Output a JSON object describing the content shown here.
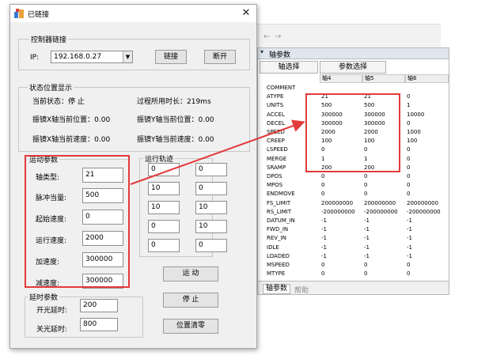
{
  "dialog": {
    "title": "已链接",
    "close_glyph": "✕",
    "controller_group": {
      "title": "控制器链接",
      "ip_label": "IP:",
      "ip_value": "192.168.0.27",
      "connect_label": "链接",
      "disconnect_label": "断开"
    },
    "status_group": {
      "title": "状态位置显示",
      "current_state": "当前状态：停 止",
      "elapsed": "过程所用时长：219ms",
      "x_pos": "振镜X轴当前位置：0.00",
      "y_pos": "振镜Y轴当前位置：0.00",
      "x_speed": "振镜X轴当前速度：0.00",
      "y_speed": "振镜Y轴当前速度：0.00"
    },
    "motion_group": {
      "title": "运动参数",
      "fields": [
        {
          "label": "轴类型:",
          "value": "21"
        },
        {
          "label": "脉冲当量:",
          "value": "500"
        },
        {
          "label": "起始速度:",
          "value": "0"
        },
        {
          "label": "运行速度:",
          "value": "2000"
        },
        {
          "label": "加速度:",
          "value": "300000"
        },
        {
          "label": "减速度:",
          "value": "300000"
        }
      ]
    },
    "trajectory_group": {
      "title": "运行轨迹",
      "rows": [
        [
          "0",
          "0"
        ],
        [
          "10",
          "0"
        ],
        [
          "10",
          "10"
        ],
        [
          "0",
          "10"
        ],
        [
          "0",
          "0"
        ]
      ]
    },
    "laser_group": {
      "title": "延时参数",
      "fields": [
        {
          "label": "开光延时:",
          "value": "200"
        },
        {
          "label": "关光延时:",
          "value": "800"
        }
      ]
    },
    "buttons": {
      "move": "运 动",
      "stop": "停 止",
      "clear": "位置清零"
    }
  },
  "axis_panel": {
    "title": "轴参数",
    "tabs": [
      "轴选择",
      "参数选择"
    ],
    "columns": [
      "轴4",
      "轴5",
      "轴6"
    ],
    "rows": [
      {
        "name": "COMMENT",
        "v": [
          "",
          "",
          ""
        ]
      },
      {
        "name": "ATYPE",
        "v": [
          "21",
          "21",
          "0"
        ]
      },
      {
        "name": "UNITS",
        "v": [
          "500",
          "500",
          "1"
        ]
      },
      {
        "name": "ACCEL",
        "v": [
          "300000",
          "300000",
          "10000"
        ]
      },
      {
        "name": "DECEL",
        "v": [
          "300000",
          "300000",
          "0"
        ]
      },
      {
        "name": "SPEED",
        "v": [
          "2000",
          "2000",
          "1000"
        ]
      },
      {
        "name": "CREEP",
        "v": [
          "100",
          "100",
          "100"
        ]
      },
      {
        "name": "LSPEED",
        "v": [
          "0",
          "0",
          "0"
        ]
      },
      {
        "name": "MERGE",
        "v": [
          "1",
          "1",
          "0"
        ]
      },
      {
        "name": "SRAMP",
        "v": [
          "200",
          "200",
          "0"
        ]
      },
      {
        "name": "DPOS",
        "v": [
          "0",
          "0",
          "0"
        ]
      },
      {
        "name": "MPOS",
        "v": [
          "0",
          "0",
          "0"
        ]
      },
      {
        "name": "ENDMOVE",
        "v": [
          "0",
          "0",
          "0"
        ]
      },
      {
        "name": "FS_LIMIT",
        "v": [
          "200000000",
          "200000000",
          "200000000"
        ]
      },
      {
        "name": "RS_LIMIT",
        "v": [
          "-200000000",
          "-200000000",
          "-200000000"
        ]
      },
      {
        "name": "DATUM_IN",
        "v": [
          "-1",
          "-1",
          "-1"
        ]
      },
      {
        "name": "FWD_IN",
        "v": [
          "-1",
          "-1",
          "-1"
        ]
      },
      {
        "name": "REV_IN",
        "v": [
          "-1",
          "-1",
          "-1"
        ]
      },
      {
        "name": "IDLE",
        "v": [
          "-1",
          "-1",
          "-1"
        ]
      },
      {
        "name": "LOADED",
        "v": [
          "-1",
          "-1",
          "-1"
        ]
      },
      {
        "name": "MSPEED",
        "v": [
          "0",
          "0",
          "0"
        ]
      },
      {
        "name": "MTYPE",
        "v": [
          "0",
          "0",
          "0"
        ]
      }
    ],
    "bottom_tabs": [
      "轴参数",
      "帮助"
    ]
  },
  "colors": {
    "highlight": "#e23b3b",
    "arrow": "#e23b3b"
  }
}
